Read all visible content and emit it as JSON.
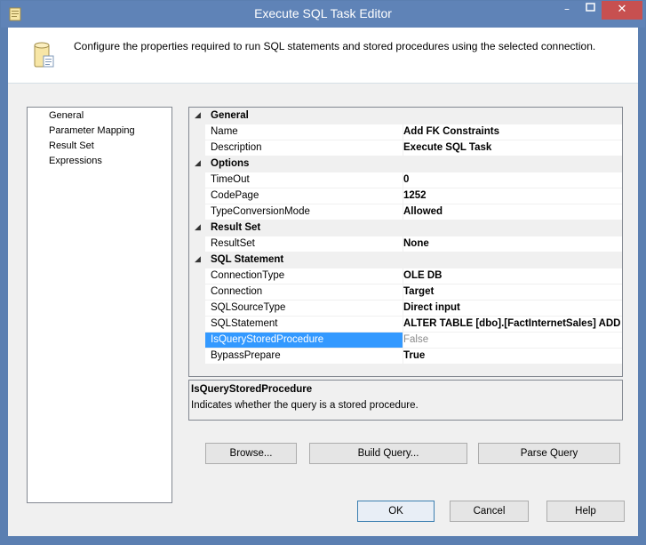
{
  "window": {
    "title": "Execute SQL Task Editor",
    "minimize_label": "–",
    "maximize_label": "□",
    "close_label": "✕"
  },
  "header": {
    "description": "Configure the properties required to run SQL statements and stored procedures using the selected connection."
  },
  "nav": {
    "items": [
      {
        "label": "General"
      },
      {
        "label": "Parameter Mapping"
      },
      {
        "label": "Result Set"
      },
      {
        "label": "Expressions"
      }
    ]
  },
  "properties": {
    "categories": [
      {
        "label": "General",
        "toggle": "◢",
        "rows": [
          {
            "name": "Name",
            "value": "Add FK Constraints"
          },
          {
            "name": "Description",
            "value": "Execute SQL Task"
          }
        ]
      },
      {
        "label": "Options",
        "toggle": "◢",
        "rows": [
          {
            "name": "TimeOut",
            "value": "0"
          },
          {
            "name": "CodePage",
            "value": "1252"
          },
          {
            "name": "TypeConversionMode",
            "value": "Allowed"
          }
        ]
      },
      {
        "label": "Result Set",
        "toggle": "◢",
        "rows": [
          {
            "name": "ResultSet",
            "value": "None"
          }
        ]
      },
      {
        "label": "SQL Statement",
        "toggle": "◢",
        "rows": [
          {
            "name": "ConnectionType",
            "value": "OLE DB"
          },
          {
            "name": "Connection",
            "value": "Target"
          },
          {
            "name": "SQLSourceType",
            "value": "Direct input"
          },
          {
            "name": "SQLStatement",
            "value": "ALTER TABLE [dbo].[FactInternetSales] ADD CONSTRAINT"
          },
          {
            "name": "IsQueryStoredProcedure",
            "value": "False"
          },
          {
            "name": "BypassPrepare",
            "value": "True"
          }
        ]
      }
    ]
  },
  "description_panel": {
    "title": "IsQueryStoredProcedure",
    "body": "Indicates whether the query is a stored procedure."
  },
  "buttons": {
    "browse": "Browse...",
    "build_query": "Build Query...",
    "parse_query": "Parse Query",
    "ok": "OK",
    "cancel": "Cancel",
    "help": "Help"
  }
}
